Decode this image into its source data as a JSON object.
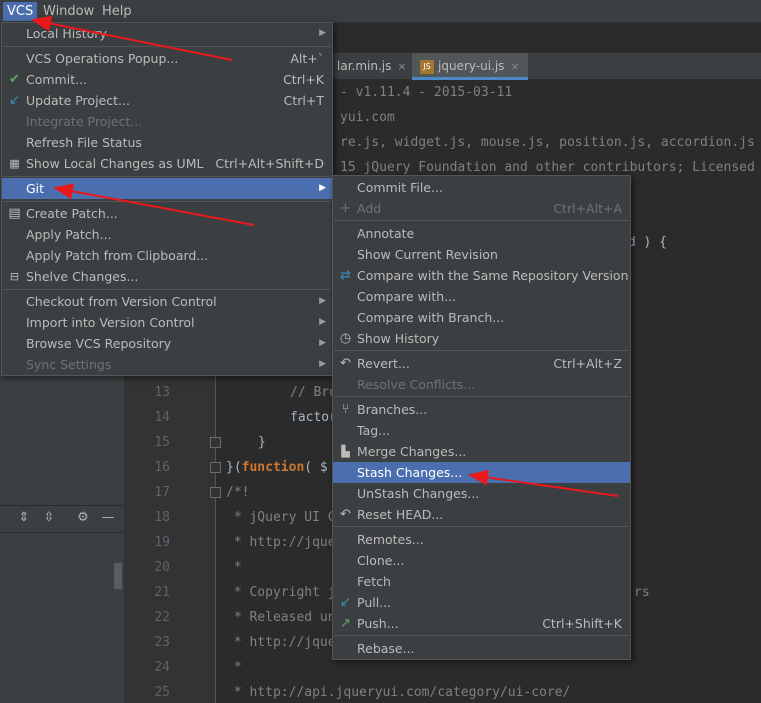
{
  "menubar": {
    "vcs": "VCS",
    "window": "Window",
    "help": "Help"
  },
  "tabs": [
    {
      "label": "lar.min.js",
      "close": "×"
    },
    {
      "label": "jquery-ui.js",
      "close": "×"
    }
  ],
  "editor": {
    "lines": [
      {
        "n": "13",
        "code": "// Bro"
      },
      {
        "n": "14",
        "code": "factor"
      },
      {
        "n": "15",
        "code": "}"
      },
      {
        "n": "16",
        "prefix": "}(",
        "kw": "function",
        "suffix": "( $"
      },
      {
        "n": "17",
        "code": "/*!"
      },
      {
        "n": "18",
        "code": " * jQuery UI C"
      },
      {
        "n": "19",
        "code": " * http://jque"
      },
      {
        "n": "20",
        "code": " *"
      },
      {
        "n": "21",
        "code": " * Copyright j"
      },
      {
        "n": "22",
        "code": " * Released un"
      },
      {
        "n": "23",
        "code": " * http://jque"
      },
      {
        "n": "24",
        "code": " *"
      },
      {
        "n": "25",
        "code": " * http://api.jqueryui.com/category/ui-core/"
      }
    ],
    "visible_fragments": {
      "l1": "- v1.11.4 - 2015-03-11",
      "l2": "yui.com",
      "l3": "re.js, widget.js, mouse.js, position.js, accordion.js",
      "l4": "15 jQuery Foundation and other contributors; Licensed",
      "l6": "nd ) {",
      "l21tail": "rs"
    }
  },
  "vcs_menu": {
    "items": {
      "local_history": "Local History",
      "ops_popup": "VCS Operations Popup...",
      "ops_popup_sc": "Alt+`",
      "commit": "Commit...",
      "commit_sc": "Ctrl+K",
      "update": "Update Project...",
      "update_sc": "Ctrl+T",
      "integrate": "Integrate Project...",
      "refresh": "Refresh File Status",
      "show_local": "Show Local Changes as UML",
      "show_local_sc": "Ctrl+Alt+Shift+D",
      "git": "Git",
      "create_patch": "Create Patch...",
      "apply_patch": "Apply Patch...",
      "apply_clip": "Apply Patch from Clipboard...",
      "shelve": "Shelve Changes...",
      "checkout": "Checkout from Version Control",
      "import": "Import into Version Control",
      "browse": "Browse VCS Repository",
      "sync": "Sync Settings"
    }
  },
  "git_menu": {
    "items": {
      "commit_file": "Commit File...",
      "add": "Add",
      "add_sc": "Ctrl+Alt+A",
      "annotate": "Annotate",
      "show_rev": "Show Current Revision",
      "compare_same": "Compare with the Same Repository Version",
      "compare_with": "Compare with...",
      "compare_branch": "Compare with Branch...",
      "show_history": "Show History",
      "revert": "Revert...",
      "revert_sc": "Ctrl+Alt+Z",
      "resolve": "Resolve Conflicts...",
      "branches": "Branches...",
      "tag": "Tag...",
      "merge": "Merge Changes...",
      "stash": "Stash Changes...",
      "unstash": "UnStash Changes...",
      "reset_head": "Reset HEAD...",
      "remotes": "Remotes...",
      "clone": "Clone...",
      "fetch": "Fetch",
      "pull": "Pull...",
      "push": "Push...",
      "push_sc": "Ctrl+Shift+K",
      "rebase": "Rebase..."
    }
  },
  "colors": {
    "highlight": "#4b6eaf",
    "annotation_arrow": "#e8191b",
    "menu_bg": "#3c3f41"
  }
}
